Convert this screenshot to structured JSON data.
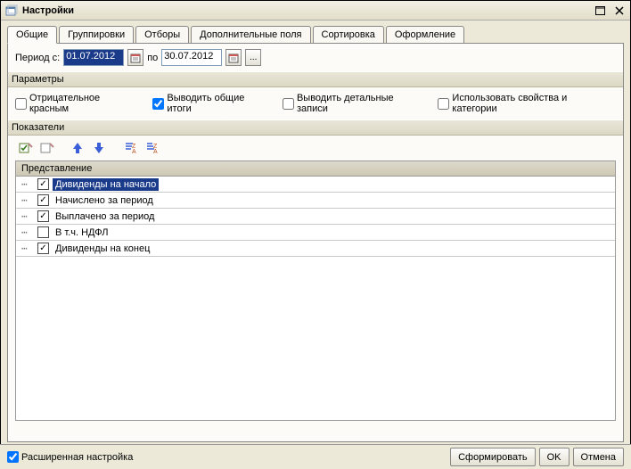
{
  "window": {
    "title": "Настройки"
  },
  "tabs": [
    {
      "label": "Общие"
    },
    {
      "label": "Группировки"
    },
    {
      "label": "Отборы"
    },
    {
      "label": "Дополнительные поля"
    },
    {
      "label": "Сортировка"
    },
    {
      "label": "Оформление"
    }
  ],
  "period": {
    "label_from": "Период с:",
    "date_from": "01.07.2012",
    "label_to": "по",
    "date_to": "30.07.2012"
  },
  "sections": {
    "params_title": "Параметры",
    "indicators_title": "Показатели"
  },
  "params": {
    "neg_red": {
      "label": "Отрицательное красным",
      "checked": false
    },
    "show_totals": {
      "label": "Выводить общие итоги",
      "checked": true
    },
    "show_details": {
      "label": "Выводить детальные записи",
      "checked": false
    },
    "use_props": {
      "label": "Использовать свойства и категории",
      "checked": false
    }
  },
  "grid": {
    "column_header": "Представление",
    "rows": [
      {
        "label": "Дивиденды на начало",
        "checked": true,
        "selected": true
      },
      {
        "label": "Начислено за период",
        "checked": true,
        "selected": false
      },
      {
        "label": "Выплачено за период",
        "checked": true,
        "selected": false
      },
      {
        "label": "В т.ч. НДФЛ",
        "checked": false,
        "selected": false
      },
      {
        "label": "Дивиденды на конец",
        "checked": true,
        "selected": false
      }
    ]
  },
  "footer": {
    "adv_label": "Расширенная настройка",
    "adv_checked": true,
    "generate": "Сформировать",
    "ok": "OK",
    "cancel": "Отмена"
  }
}
